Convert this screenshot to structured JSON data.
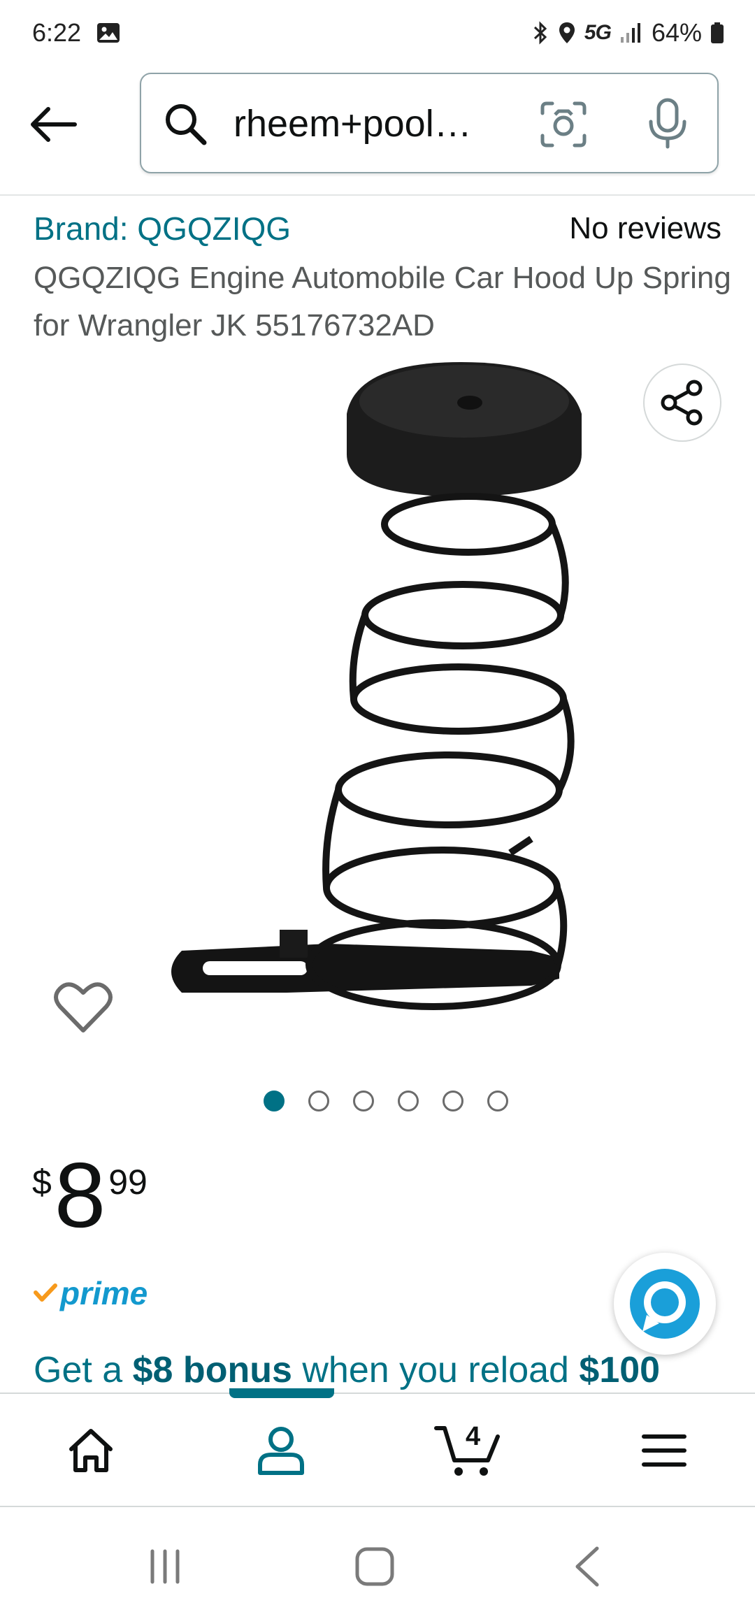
{
  "status_bar": {
    "time": "6:22",
    "network": "5G",
    "battery": "64%"
  },
  "search": {
    "query": "rheem+pool…"
  },
  "product": {
    "brand": "Brand: QGQZIQG",
    "reviews": "No reviews",
    "title": "QGQZIQG Engine Automobile Car Hood Up Spring for Wrangler JK 55176732AD"
  },
  "carousel": {
    "total_images": 6,
    "active_index": 0
  },
  "price": {
    "symbol": "$",
    "whole": "8",
    "fraction": "99"
  },
  "prime": {
    "label": "prime"
  },
  "promo": {
    "part1": "Get a ",
    "bold1": "$8 bonus",
    "part2": " when you reload ",
    "bold2": "$100"
  },
  "bottom_nav": {
    "cart_count": "4",
    "active_tab": "account"
  },
  "colors": {
    "link_teal": "#007185",
    "prime_blue": "#1399ce",
    "alexa_blue": "#1a9fd9"
  }
}
